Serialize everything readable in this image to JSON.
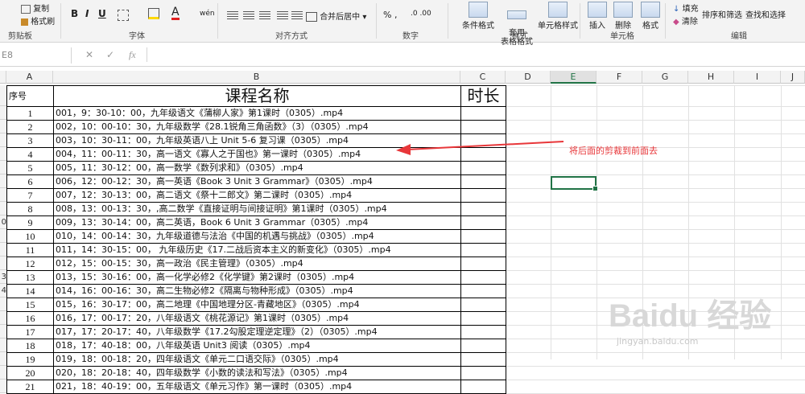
{
  "ribbon": {
    "clipboard": {
      "copy": "复制",
      "format_painter": "格式刷",
      "label": "剪贴板"
    },
    "font": {
      "label": "字体",
      "bold": "B",
      "italic": "I",
      "underline": "U",
      "wen": "wén"
    },
    "alignment": {
      "merge_center": "合并后居中",
      "label": "对齐方式"
    },
    "number": {
      "label": "数字"
    },
    "styles": {
      "conditional": "条件格式",
      "table_format": "套用\n表格格式",
      "cell_styles": "单元格样式",
      "label": "样式"
    },
    "cells": {
      "insert": "插入",
      "delete": "删除",
      "format": "格式",
      "label": "单元格"
    },
    "editing": {
      "fill": "填充",
      "clear": "清除",
      "sort_filter": "排序和筛选",
      "find_select": "查找和选择",
      "label": "编辑"
    }
  },
  "formula_bar": {
    "name_box": "E8",
    "cancel": "✕",
    "enter": "✓",
    "fx": "fx",
    "value": ""
  },
  "columns": [
    "A",
    "B",
    "C",
    "D",
    "E",
    "F",
    "G",
    "H",
    "I",
    "J"
  ],
  "selected_column": "E",
  "row_numbers": [
    "",
    "",
    "",
    "",
    "",
    "",
    "",
    "",
    "",
    "0",
    "",
    "",
    "",
    "3",
    "4",
    "",
    "",
    "",
    "",
    "",
    "",
    ""
  ],
  "header": {
    "seq": "序号",
    "course": "课程名称",
    "duration": "时长"
  },
  "rows": [
    {
      "n": "1",
      "t": "001，9：30-10：00，九年级语文《蒲柳人家》第1课时（0305）.mp4"
    },
    {
      "n": "2",
      "t": "002，10：00-10：30，九年级数学《28.1锐角三角函数》（3）（0305）.mp4"
    },
    {
      "n": "3",
      "t": "003，10：30-11：00，九年级英语八上 Unit 5-6  复习课（0305）.mp4"
    },
    {
      "n": "4",
      "t": "004，11：00-11：30，高一语文《寡人之于国也》第一课时（0305）.mp4"
    },
    {
      "n": "5",
      "t": "005，11：30-12：00，高一数学《数列求和》（0305）.mp4"
    },
    {
      "n": "6",
      "t": "006，12：00-12：30，高一英语《Book 3 Unit 3 Grammar》（0305）.mp4"
    },
    {
      "n": "7",
      "t": "007，12：30-13：00，高二语文《祭十二郎文》第二课时（0305）.mp4"
    },
    {
      "n": "8",
      "t": "008，13：00-13：30，,高二数学《直接证明与间接证明》第1课时（0305）.mp4"
    },
    {
      "n": "9",
      "t": "009，13：30-14：00，高二英语，Book 6 Unit 3 Grammar（0305）.mp4"
    },
    {
      "n": "10",
      "t": "010，14：00-14：30，九年级道德与法治《中国的机遇与挑战》（0305）.mp4"
    },
    {
      "n": "11",
      "t": "011，14：30-15：00，  九年级历史《17.二战后资本主义的新变化》（0305）.mp4"
    },
    {
      "n": "12",
      "t": "012，15：00-15：30，高一政治《民主管理》（0305）.mp4"
    },
    {
      "n": "13",
      "t": "013，15：30-16：00，高一化学必修2《化学键》第2课时（0305）.mp4"
    },
    {
      "n": "14",
      "t": "014，16：00-16：30，高二生物必修2《隔离与物种形成》（0305）.mp4"
    },
    {
      "n": "15",
      "t": "015，16：30-17：00，高二地理《中国地理分区-青藏地区》（0305）.mp4"
    },
    {
      "n": "16",
      "t": "016，17：00-17：20，八年级语文《桃花源记》第1课时（0305）.mp4"
    },
    {
      "n": "17",
      "t": "017，17：20-17：40，八年级数学《17.2勾股定理逆定理》（2）（0305）.mp4"
    },
    {
      "n": "18",
      "t": "018，17：40-18：00，八年级英语 Unit3 阅读（0305）.mp4"
    },
    {
      "n": "19",
      "t": "019，18：00-18：20，四年级语文《单元二口语交际》（0305）.mp4"
    },
    {
      "n": "20",
      "t": "020，18：20-18：40，四年级数学《小数的读法和写法》（0305）.mp4"
    },
    {
      "n": "21",
      "t": "021，18：40-19：00，五年级语文《单元习作》第一课时（0305）.mp4"
    }
  ],
  "annotation": "将后面的剪裁到前面去",
  "watermark": {
    "brand": "Baidu 经验",
    "url": "jingyan.baidu.com"
  },
  "colors": {
    "accent": "#217346",
    "arrow": "#e8373a"
  }
}
